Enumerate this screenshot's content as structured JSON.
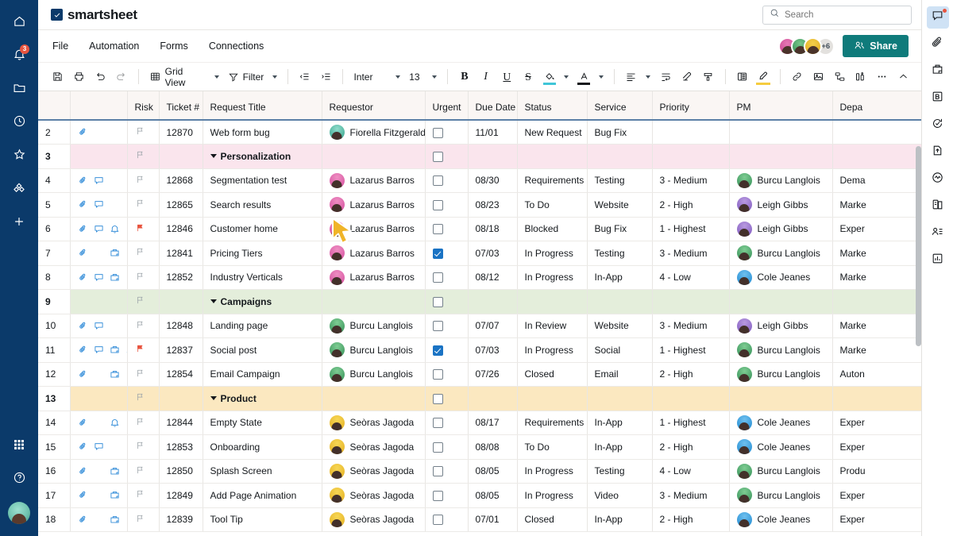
{
  "app": {
    "brand": "smartsheet",
    "accent_teal": "#0f7b7b",
    "rail_bg": "#0b3a6a"
  },
  "left_rail": {
    "items": [
      {
        "name": "home",
        "icon": "home-icon"
      },
      {
        "name": "notifications",
        "icon": "bell-icon",
        "badge": "3"
      },
      {
        "name": "browse",
        "icon": "folder-icon"
      },
      {
        "name": "recents",
        "icon": "clock-icon"
      },
      {
        "name": "favorites",
        "icon": "star-icon"
      },
      {
        "name": "workapps",
        "icon": "workapps-icon"
      },
      {
        "name": "create",
        "icon": "plus-icon"
      }
    ],
    "bottom": [
      {
        "name": "app-switcher",
        "icon": "grid-apps-icon"
      },
      {
        "name": "help",
        "icon": "help-icon"
      },
      {
        "name": "account",
        "icon": "user-avatar"
      }
    ]
  },
  "header": {
    "search": {
      "placeholder": "Search",
      "value": ""
    }
  },
  "menubar": {
    "items": [
      {
        "label": "File"
      },
      {
        "label": "Automation"
      },
      {
        "label": "Forms"
      },
      {
        "label": "Connections"
      }
    ],
    "collaborators_overflow": "+6",
    "share_label": "Share"
  },
  "toolbar": {
    "save_title": "Save",
    "print_title": "Print",
    "undo_title": "Undo",
    "redo_title": "Redo",
    "view_label": "Grid View",
    "filter_label": "Filter",
    "font_family_value": "Inter",
    "font_size_value": "13",
    "bold_label": "B",
    "italic_label": "I",
    "underline_label": "U",
    "strikethrough_label": "S"
  },
  "grid": {
    "columns": [
      {
        "key": "rownum",
        "label": ""
      },
      {
        "key": "rowicons",
        "label": ""
      },
      {
        "key": "risk",
        "label": "Risk"
      },
      {
        "key": "ticket",
        "label": "Ticket #"
      },
      {
        "key": "title",
        "label": "Request Title",
        "selected": true
      },
      {
        "key": "requestor",
        "label": "Requestor"
      },
      {
        "key": "urgent",
        "label": "Urgent"
      },
      {
        "key": "due",
        "label": "Due Date"
      },
      {
        "key": "status",
        "label": "Status"
      },
      {
        "key": "service",
        "label": "Service"
      },
      {
        "key": "priority",
        "label": "Priority"
      },
      {
        "key": "pm",
        "label": "PM"
      },
      {
        "key": "dept",
        "label": "Depa"
      }
    ],
    "rows": [
      {
        "rownum": "2",
        "type": "data",
        "icons": [
          "attachment"
        ],
        "risk_flag": false,
        "ticket": "12870",
        "title": "Web form bug",
        "requestor": "Fiorella Fitzgerald",
        "requestor_av": "teal",
        "urgent": false,
        "due": "11/01",
        "status": "New Request",
        "service": "Bug Fix",
        "priority": "",
        "pm": "",
        "pm_av": "",
        "dept": ""
      },
      {
        "rownum": "3",
        "type": "group",
        "group_color": "pink",
        "title": "Personalization",
        "urgent": false
      },
      {
        "rownum": "4",
        "type": "data",
        "icons": [
          "attachment",
          "comment"
        ],
        "risk_flag": false,
        "ticket": "12868",
        "title": "Segmentation test",
        "requestor": "Lazarus Barros",
        "requestor_av": "pink",
        "urgent": false,
        "due": "08/30",
        "status": "Requirements",
        "service": "Testing",
        "priority": "3 - Medium",
        "pm": "Burcu Langlois",
        "pm_av": "green",
        "dept": "Dema"
      },
      {
        "rownum": "5",
        "type": "data",
        "icons": [
          "attachment",
          "comment"
        ],
        "risk_flag": false,
        "ticket": "12865",
        "title": "Search results",
        "requestor": "Lazarus Barros",
        "requestor_av": "pink",
        "urgent": false,
        "due": "08/23",
        "status": "To Do",
        "service": "Website",
        "priority": "2 - High",
        "pm": "Leigh Gibbs",
        "pm_av": "purple",
        "dept": "Marke"
      },
      {
        "rownum": "6",
        "type": "data",
        "icons": [
          "attachment",
          "comment",
          "reminder"
        ],
        "risk_flag": true,
        "ticket": "12846",
        "title": "Customer home",
        "requestor": "Lazarus Barros",
        "requestor_av": "pink",
        "urgent": false,
        "due": "08/18",
        "status": "Blocked",
        "service": "Bug Fix",
        "priority": "1 - Highest",
        "pm": "Leigh Gibbs",
        "pm_av": "purple",
        "dept": "Exper"
      },
      {
        "rownum": "7",
        "type": "data",
        "icons": [
          "attachment",
          "",
          "proof"
        ],
        "risk_flag": false,
        "ticket": "12841",
        "title": "Pricing Tiers",
        "requestor": "Lazarus Barros",
        "requestor_av": "pink",
        "urgent": true,
        "due": "07/03",
        "status": "In Progress",
        "service": "Testing",
        "priority": "3 - Medium",
        "pm": "Burcu Langlois",
        "pm_av": "green",
        "dept": "Marke"
      },
      {
        "rownum": "8",
        "type": "data",
        "icons": [
          "attachment",
          "comment",
          "proof"
        ],
        "risk_flag": false,
        "ticket": "12852",
        "title": "Industry Verticals",
        "requestor": "Lazarus Barros",
        "requestor_av": "pink",
        "urgent": false,
        "due": "08/12",
        "status": "In Progress",
        "service": "In-App",
        "priority": "4 - Low",
        "pm": "Cole Jeanes",
        "pm_av": "blue",
        "dept": "Marke"
      },
      {
        "rownum": "9",
        "type": "group",
        "group_color": "green",
        "title": "Campaigns",
        "urgent": false
      },
      {
        "rownum": "10",
        "type": "data",
        "icons": [
          "attachment",
          "comment"
        ],
        "risk_flag": false,
        "ticket": "12848",
        "title": "Landing page",
        "requestor": "Burcu Langlois",
        "requestor_av": "green",
        "urgent": false,
        "due": "07/07",
        "status": "In Review",
        "service": "Website",
        "priority": "3 - Medium",
        "pm": "Leigh Gibbs",
        "pm_av": "purple",
        "dept": "Marke"
      },
      {
        "rownum": "11",
        "type": "data",
        "icons": [
          "attachment",
          "comment",
          "proof",
          "reminder"
        ],
        "risk_flag": true,
        "ticket": "12837",
        "title": "Social post",
        "requestor": "Burcu Langlois",
        "requestor_av": "green",
        "urgent": true,
        "due": "07/03",
        "status": "In Progress",
        "service": "Social",
        "priority": "1 - Highest",
        "pm": "Burcu Langlois",
        "pm_av": "green",
        "dept": "Marke"
      },
      {
        "rownum": "12",
        "type": "data",
        "icons": [
          "attachment",
          "",
          "proof"
        ],
        "risk_flag": false,
        "ticket": "12854",
        "title": "Email Campaign",
        "requestor": "Burcu Langlois",
        "requestor_av": "green",
        "urgent": false,
        "due": "07/26",
        "status": "Closed",
        "service": "Email",
        "priority": "2 - High",
        "pm": "Burcu Langlois",
        "pm_av": "green",
        "dept": "Auton"
      },
      {
        "rownum": "13",
        "type": "group",
        "group_color": "amber",
        "title": "Product",
        "urgent": false
      },
      {
        "rownum": "14",
        "type": "data",
        "icons": [
          "attachment",
          "",
          "reminder"
        ],
        "risk_flag": false,
        "ticket": "12844",
        "title": "Empty State",
        "requestor": "Seòras Jagoda",
        "requestor_av": "gold",
        "urgent": false,
        "due": "08/17",
        "status": "Requirements",
        "service": "In-App",
        "priority": "1 - Highest",
        "pm": "Cole Jeanes",
        "pm_av": "blue",
        "dept": "Exper"
      },
      {
        "rownum": "15",
        "type": "data",
        "icons": [
          "attachment",
          "comment"
        ],
        "risk_flag": false,
        "ticket": "12853",
        "title": "Onboarding",
        "requestor": "Seòras Jagoda",
        "requestor_av": "gold",
        "urgent": false,
        "due": "08/08",
        "status": "To Do",
        "service": "In-App",
        "priority": "2 - High",
        "pm": "Cole Jeanes",
        "pm_av": "blue",
        "dept": "Exper"
      },
      {
        "rownum": "16",
        "type": "data",
        "icons": [
          "attachment",
          "",
          "proof"
        ],
        "risk_flag": false,
        "ticket": "12850",
        "title": "Splash Screen",
        "requestor": "Seòras Jagoda",
        "requestor_av": "gold",
        "urgent": false,
        "due": "08/05",
        "status": "In Progress",
        "service": "Testing",
        "priority": "4 - Low",
        "pm": "Burcu Langlois",
        "pm_av": "green",
        "dept": "Produ"
      },
      {
        "rownum": "17",
        "type": "data",
        "icons": [
          "attachment",
          "",
          "proof"
        ],
        "risk_flag": false,
        "ticket": "12849",
        "title": "Add Page Animation",
        "requestor": "Seòras Jagoda",
        "requestor_av": "gold",
        "urgent": false,
        "due": "08/05",
        "status": "In Progress",
        "service": "Video",
        "priority": "3 - Medium",
        "pm": "Burcu Langlois",
        "pm_av": "green",
        "dept": "Exper"
      },
      {
        "rownum": "18",
        "type": "data",
        "icons": [
          "attachment",
          "",
          "proof"
        ],
        "risk_flag": false,
        "ticket": "12839",
        "title": "Tool Tip",
        "requestor": "Seòras Jagoda",
        "requestor_av": "gold",
        "urgent": false,
        "due": "07/01",
        "status": "Closed",
        "service": "In-App",
        "priority": "2 - High",
        "pm": "Cole Jeanes",
        "pm_av": "blue",
        "dept": "Exper"
      }
    ]
  },
  "right_rail": {
    "items": [
      {
        "name": "conversations",
        "icon": "conversation-icon",
        "active": true,
        "dot": true
      },
      {
        "name": "attachments",
        "icon": "paperclip-icon"
      },
      {
        "name": "proofs",
        "icon": "proof-icon"
      },
      {
        "name": "brandfolder",
        "icon": "brandfolder-icon"
      },
      {
        "name": "update-requests",
        "icon": "update-request-icon"
      },
      {
        "name": "publish",
        "icon": "publish-icon"
      },
      {
        "name": "activity-log",
        "icon": "activity-log-icon"
      },
      {
        "name": "summary",
        "icon": "summary-icon"
      },
      {
        "name": "contacts",
        "icon": "contacts-icon"
      },
      {
        "name": "charts",
        "icon": "chart-icon"
      }
    ]
  }
}
